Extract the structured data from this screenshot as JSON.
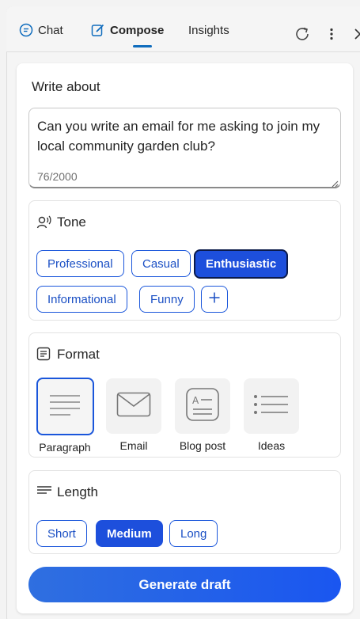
{
  "tabs": {
    "chat": "Chat",
    "compose": "Compose",
    "insights": "Insights"
  },
  "write_about": {
    "label": "Write about",
    "value": "Can you write an email for me asking to join my local community garden club?",
    "counter": "76/2000"
  },
  "tone": {
    "title": "Tone",
    "options": [
      "Professional",
      "Casual",
      "Enthusiastic",
      "Informational",
      "Funny"
    ],
    "selected": "Enthusiastic",
    "add_icon": "plus-icon"
  },
  "format": {
    "title": "Format",
    "options": [
      "Paragraph",
      "Email",
      "Blog post",
      "Ideas"
    ],
    "selected": "Paragraph"
  },
  "length": {
    "title": "Length",
    "options": [
      "Short",
      "Medium",
      "Long"
    ],
    "selected": "Medium"
  },
  "generate_label": "Generate draft",
  "colors": {
    "accent": "#1d4fdc",
    "tab_underline": "#0f6cbd"
  }
}
